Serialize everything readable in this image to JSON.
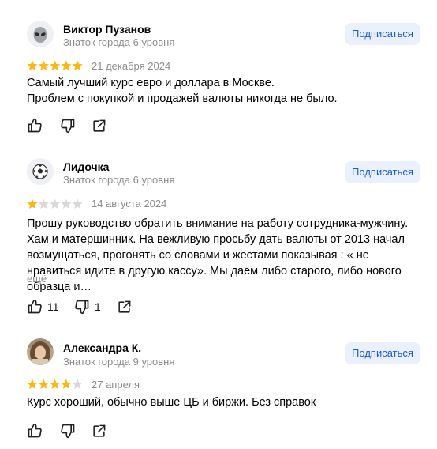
{
  "reviews": [
    {
      "author": "Виктор Пузанов",
      "level": "Знаток города 6 уровня",
      "subscribe_label": "Подписаться",
      "rating": 5,
      "date": "21 декабря 2024",
      "text": "Самый лучший курс евро и доллара в Москве.\nПроблем с покупкой и продажей валюты никогда не было.",
      "avatar_icon": "alien-face-icon",
      "likes": "",
      "dislikes": ""
    },
    {
      "author": "Лидочка",
      "level": "Знаток города 6 уровня",
      "subscribe_label": "Подписаться",
      "rating": 1,
      "date": "14 августа 2024",
      "text": "Прошу руководство обратить внимание на работу сотрудника-мужчину. Хам и матершинник. На вежливую просьбу дать валюты от 2013 начал возмущаться, прогонять со словами и жестами показывая : « не нравиться идите в другую кассу». Мы даем либо старого, либо нового образца и…",
      "more_label": "ещё",
      "avatar_icon": "soccer-ball-icon",
      "likes": "11",
      "dislikes": "1"
    },
    {
      "author": "Александра К.",
      "level": "Знаток города 9 уровня",
      "subscribe_label": "Подписаться",
      "rating": 4,
      "date": "27 апреля",
      "text": "Курс хороший, обычно выше ЦБ и биржи. Без справок",
      "avatar_icon": "user-photo-avatar",
      "likes": "",
      "dislikes": ""
    }
  ],
  "colors": {
    "star_filled": "#fdb813",
    "star_empty": "#d9d9d9",
    "subscribe_bg": "#eaf1fc",
    "subscribe_text": "#1a5bd6",
    "muted_text": "#8c8c8c"
  }
}
